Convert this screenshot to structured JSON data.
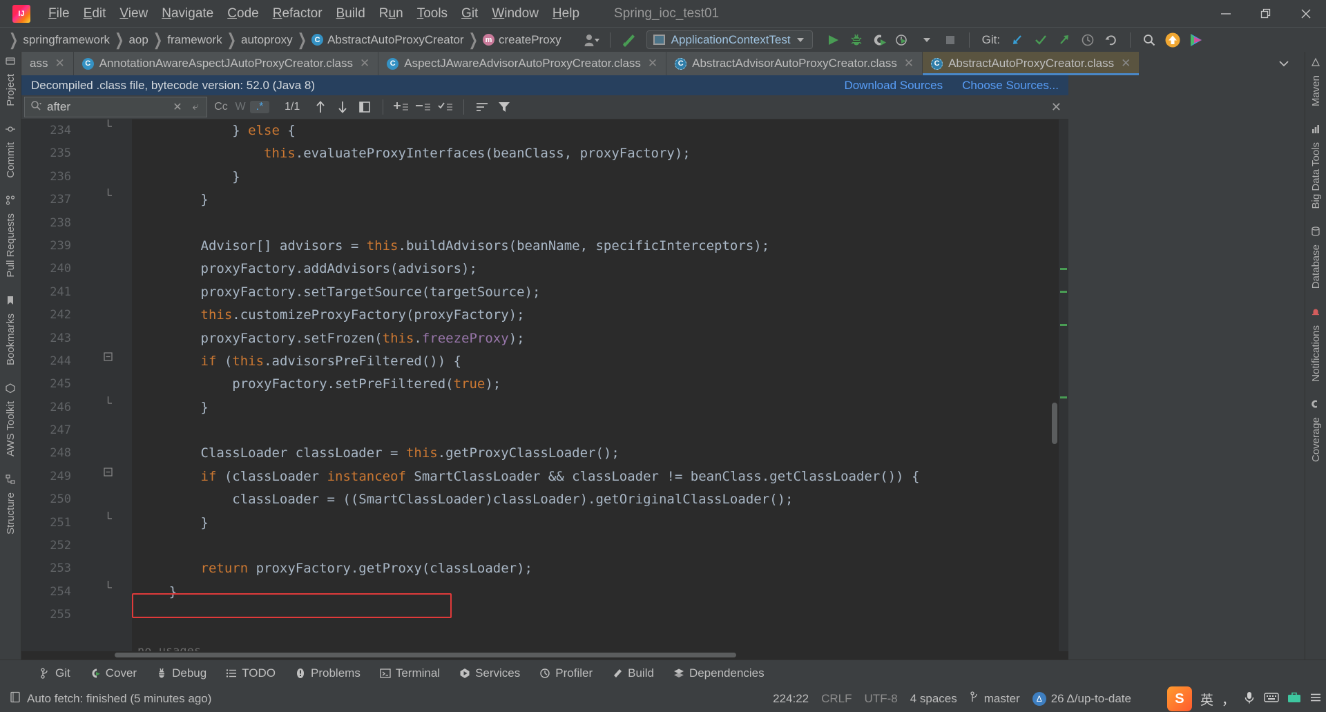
{
  "window": {
    "title": "Spring_ioc_test01",
    "controls": {
      "minimize": "minimize-icon",
      "maximize": "restore-icon",
      "close": "close-icon"
    }
  },
  "menu": {
    "items": [
      {
        "label": "File",
        "mnemonic": "F"
      },
      {
        "label": "Edit",
        "mnemonic": "E"
      },
      {
        "label": "View",
        "mnemonic": "V"
      },
      {
        "label": "Navigate",
        "mnemonic": "N"
      },
      {
        "label": "Code",
        "mnemonic": "C"
      },
      {
        "label": "Refactor",
        "mnemonic": "R"
      },
      {
        "label": "Build",
        "mnemonic": "B"
      },
      {
        "label": "Run",
        "mnemonic": "u"
      },
      {
        "label": "Tools",
        "mnemonic": "T"
      },
      {
        "label": "Git",
        "mnemonic": "G"
      },
      {
        "label": "Window",
        "mnemonic": "W"
      },
      {
        "label": "Help",
        "mnemonic": "H"
      }
    ]
  },
  "navbar": {
    "breadcrumbs": [
      {
        "label": "springframework",
        "icon": ""
      },
      {
        "label": "aop",
        "icon": ""
      },
      {
        "label": "framework",
        "icon": ""
      },
      {
        "label": "autoproxy",
        "icon": ""
      },
      {
        "label": "AbstractAutoProxyCreator",
        "icon": "class-badge"
      },
      {
        "label": "createProxy",
        "icon": "method-badge"
      }
    ],
    "run_config": "ApplicationContextTest",
    "git_label": "Git:",
    "buttons": [
      "run-button",
      "debug-button",
      "run-with-coverage-button",
      "profiler-button",
      "stop-button",
      "git-update-button",
      "git-commit-button",
      "git-push-button",
      "git-history-button",
      "git-rollback-button",
      "search-everywhere-button",
      "update-available-button",
      "feedback-button"
    ]
  },
  "tabs": {
    "items": [
      {
        "label": "ass",
        "icon": "class-icon",
        "active": false,
        "truncated": true
      },
      {
        "label": "AnnotationAwareAspectJAutoProxyCreator.class",
        "icon": "class-icon",
        "active": false
      },
      {
        "label": "AspectJAwareAdvisorAutoProxyCreator.class",
        "icon": "class-icon",
        "active": false
      },
      {
        "label": "AbstractAdvisorAutoProxyCreator.class",
        "icon": "abstract-class-icon",
        "active": false
      },
      {
        "label": "AbstractAutoProxyCreator.class",
        "icon": "abstract-class-icon",
        "active": true
      }
    ],
    "overflow_label": "chevron-down-icon",
    "options_label": "more-options-icon"
  },
  "banner": {
    "text": "Decompiled .class file, bytecode version: 52.0 (Java 8)",
    "links": [
      "Download Sources",
      "Choose Sources..."
    ]
  },
  "search": {
    "value": "after",
    "placeholder": "Search",
    "match_count": "1/1",
    "options": [
      {
        "label": "Cc",
        "name": "match-case-toggle",
        "state": "off"
      },
      {
        "label": "W",
        "name": "words-toggle",
        "state": "disabled"
      },
      {
        "label": ".*",
        "name": "regex-toggle",
        "state": "on"
      }
    ],
    "buttons": [
      "previous-occurrence-button",
      "next-occurrence-button",
      "select-all-occurrences-button",
      "add-line-before-button",
      "remove-line-button",
      "toggle-selection-button",
      "filter-results-button",
      "filter-button",
      "close-search-button"
    ]
  },
  "left_strip": {
    "items": [
      {
        "label": "Project",
        "icon": "project-icon"
      },
      {
        "label": "Commit",
        "icon": "commit-icon"
      },
      {
        "label": "Pull Requests",
        "icon": "pull-requests-icon"
      },
      {
        "label": "Bookmarks",
        "icon": "bookmarks-icon"
      },
      {
        "label": "AWS Toolkit",
        "icon": "aws-icon"
      },
      {
        "label": "Structure",
        "icon": "structure-icon"
      }
    ]
  },
  "right_strip": {
    "items": [
      {
        "label": "Maven",
        "icon": "maven-icon"
      },
      {
        "label": "Big Data Tools",
        "icon": "big-data-icon"
      },
      {
        "label": "Database",
        "icon": "database-icon"
      },
      {
        "label": "Notifications",
        "icon": "notifications-icon"
      },
      {
        "label": "Coverage",
        "icon": "coverage-icon"
      }
    ]
  },
  "editor": {
    "no_usages": "no usages",
    "highlight_line": 253,
    "lines": [
      {
        "n": 234,
        "fold": "end",
        "indent": 3,
        "tokens": [
          {
            "t": "} ",
            "c": "pun"
          },
          {
            "t": "else",
            "c": "kw"
          },
          {
            "t": " {",
            "c": "pun"
          }
        ]
      },
      {
        "n": 235,
        "fold": "",
        "indent": 4,
        "tokens": [
          {
            "t": "this",
            "c": "kw"
          },
          {
            "t": ".evaluateProxyInterfaces(beanClass, proxyFactory);",
            "c": "pun"
          }
        ]
      },
      {
        "n": 236,
        "fold": "",
        "indent": 3,
        "tokens": [
          {
            "t": "}",
            "c": "pun"
          }
        ]
      },
      {
        "n": 237,
        "fold": "end",
        "indent": 2,
        "tokens": [
          {
            "t": "}",
            "c": "pun"
          }
        ]
      },
      {
        "n": 238,
        "fold": "",
        "indent": 0,
        "tokens": []
      },
      {
        "n": 239,
        "fold": "",
        "indent": 2,
        "tokens": [
          {
            "t": "Advisor[] advisors = ",
            "c": "pun"
          },
          {
            "t": "this",
            "c": "kw"
          },
          {
            "t": ".buildAdvisors(beanName, specificInterceptors);",
            "c": "pun"
          }
        ]
      },
      {
        "n": 240,
        "fold": "",
        "indent": 2,
        "tokens": [
          {
            "t": "proxyFactory.addAdvisors(advisors);",
            "c": "pun"
          }
        ]
      },
      {
        "n": 241,
        "fold": "",
        "indent": 2,
        "tokens": [
          {
            "t": "proxyFactory.setTargetSource(targetSource);",
            "c": "pun"
          }
        ]
      },
      {
        "n": 242,
        "fold": "",
        "indent": 2,
        "tokens": [
          {
            "t": "this",
            "c": "kw"
          },
          {
            "t": ".customizeProxyFactory(proxyFactory);",
            "c": "pun"
          }
        ]
      },
      {
        "n": 243,
        "fold": "",
        "indent": 2,
        "tokens": [
          {
            "t": "proxyFactory.setFrozen(",
            "c": "pun"
          },
          {
            "t": "this",
            "c": "kw"
          },
          {
            "t": ".",
            "c": "pun"
          },
          {
            "t": "freezeProxy",
            "c": "fld"
          },
          {
            "t": ");",
            "c": "pun"
          }
        ]
      },
      {
        "n": 244,
        "fold": "start",
        "indent": 2,
        "tokens": [
          {
            "t": "if",
            "c": "kw"
          },
          {
            "t": " (",
            "c": "pun"
          },
          {
            "t": "this",
            "c": "kw"
          },
          {
            "t": ".advisorsPreFiltered()) {",
            "c": "pun"
          }
        ]
      },
      {
        "n": 245,
        "fold": "",
        "indent": 3,
        "tokens": [
          {
            "t": "proxyFactory.setPreFiltered(",
            "c": "pun"
          },
          {
            "t": "true",
            "c": "kw"
          },
          {
            "t": ");",
            "c": "pun"
          }
        ]
      },
      {
        "n": 246,
        "fold": "end",
        "indent": 2,
        "tokens": [
          {
            "t": "}",
            "c": "pun"
          }
        ]
      },
      {
        "n": 247,
        "fold": "",
        "indent": 0,
        "tokens": []
      },
      {
        "n": 248,
        "fold": "",
        "indent": 2,
        "tokens": [
          {
            "t": "ClassLoader classLoader = ",
            "c": "pun"
          },
          {
            "t": "this",
            "c": "kw"
          },
          {
            "t": ".getProxyClassLoader();",
            "c": "pun"
          }
        ]
      },
      {
        "n": 249,
        "fold": "start",
        "indent": 2,
        "tokens": [
          {
            "t": "if",
            "c": "kw"
          },
          {
            "t": " (classLoader ",
            "c": "pun"
          },
          {
            "t": "instanceof",
            "c": "kw"
          },
          {
            "t": " SmartClassLoader && classLoader != beanClass.getClassLoader()) {",
            "c": "pun"
          }
        ]
      },
      {
        "n": 250,
        "fold": "",
        "indent": 3,
        "tokens": [
          {
            "t": "classLoader = ((SmartClassLoader)classLoader).getOriginalClassLoader();",
            "c": "pun"
          }
        ]
      },
      {
        "n": 251,
        "fold": "end",
        "indent": 2,
        "tokens": [
          {
            "t": "}",
            "c": "pun"
          }
        ]
      },
      {
        "n": 252,
        "fold": "",
        "indent": 0,
        "tokens": []
      },
      {
        "n": 253,
        "fold": "",
        "indent": 2,
        "tokens": [
          {
            "t": "return",
            "c": "kw"
          },
          {
            "t": " proxyFactory.getProxy(classLoader);",
            "c": "pun"
          }
        ]
      },
      {
        "n": 254,
        "fold": "end",
        "indent": 1,
        "tokens": [
          {
            "t": "}",
            "c": "pun"
          }
        ]
      },
      {
        "n": 255,
        "fold": "",
        "indent": 0,
        "tokens": []
      }
    ]
  },
  "bottom_bar": {
    "items": [
      {
        "label": "Git",
        "icon": "git-icon"
      },
      {
        "label": "Cover",
        "icon": "coverage-icon"
      },
      {
        "label": "Debug",
        "icon": "debug-icon"
      },
      {
        "label": "TODO",
        "icon": "todo-icon"
      },
      {
        "label": "Problems",
        "icon": "problems-icon"
      },
      {
        "label": "Terminal",
        "icon": "terminal-icon"
      },
      {
        "label": "Services",
        "icon": "services-icon"
      },
      {
        "label": "Profiler",
        "icon": "profiler-icon"
      },
      {
        "label": "Build",
        "icon": "build-icon"
      },
      {
        "label": "Dependencies",
        "icon": "dependencies-icon"
      }
    ]
  },
  "status_bar": {
    "message": "Auto fetch: finished (5 minutes ago)",
    "caret_position": "224:22",
    "line_separator": "CRLF",
    "encoding": "UTF-8",
    "indent": "4 spaces",
    "branch": "master",
    "vcs_status": "26 Δ/up-to-date",
    "ime": {
      "lang": "英",
      "punctuation": "，"
    },
    "ime_icons": [
      "microphone-icon",
      "keyboard-icon",
      "toolbox-icon",
      "menu-icon"
    ]
  },
  "colors": {
    "bg": "#3c3f41",
    "editor_bg": "#2b2b2b",
    "accent_blue": "#4a88c7",
    "banner_bg": "#27405e",
    "link": "#589df6",
    "highlight_red": "#e03a3a",
    "active_tab": "#5a5440",
    "keyword": "#cc7832",
    "field": "#9876aa",
    "text": "#a9b7c6"
  }
}
